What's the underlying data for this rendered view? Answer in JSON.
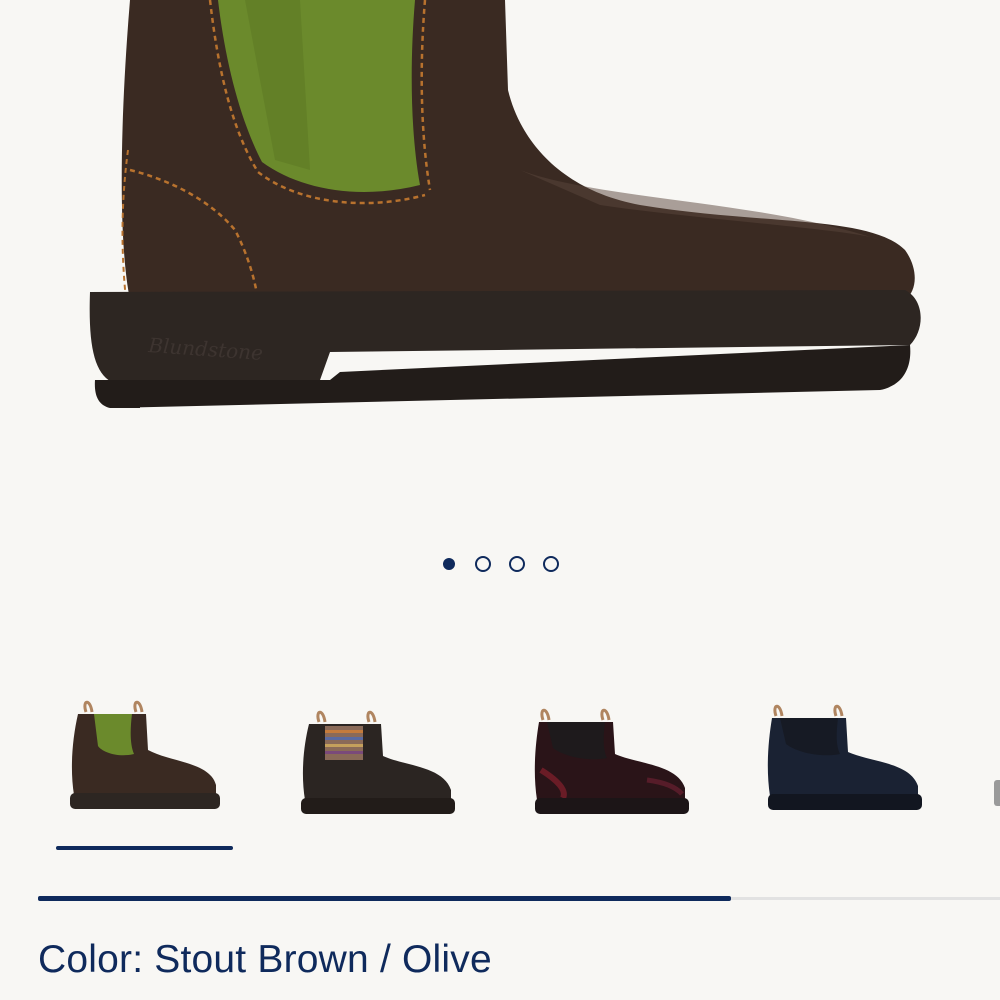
{
  "hero": {
    "image": "boot-stout-brown-olive-side-view",
    "brand_embossing": "Blundstone",
    "colors": {
      "leather": "#3a2a22",
      "elastic": "#6b8a2c",
      "stitching": "#b8722e",
      "sole": "#2d2622"
    }
  },
  "carousel": {
    "slide_count": 4,
    "active_index": 0,
    "dot_color": "#0f2a5c"
  },
  "swatches": [
    {
      "name": "stout-brown-olive",
      "selected": true,
      "leather": "#3a2a22",
      "elastic": "#6b8a2c"
    },
    {
      "name": "brown-stripe",
      "selected": false,
      "leather": "#2b2522",
      "elastic": "#8a6a58"
    },
    {
      "name": "burgundy-rub",
      "selected": false,
      "leather": "#2a1418",
      "elastic": "#1e1a1c"
    },
    {
      "name": "navy",
      "selected": false,
      "leather": "#1a2233",
      "elastic": "#161a24"
    }
  ],
  "scroll_progress": 0.72,
  "color_label": "Color: Stout Brown / Olive",
  "accent": "#0f2a5c"
}
